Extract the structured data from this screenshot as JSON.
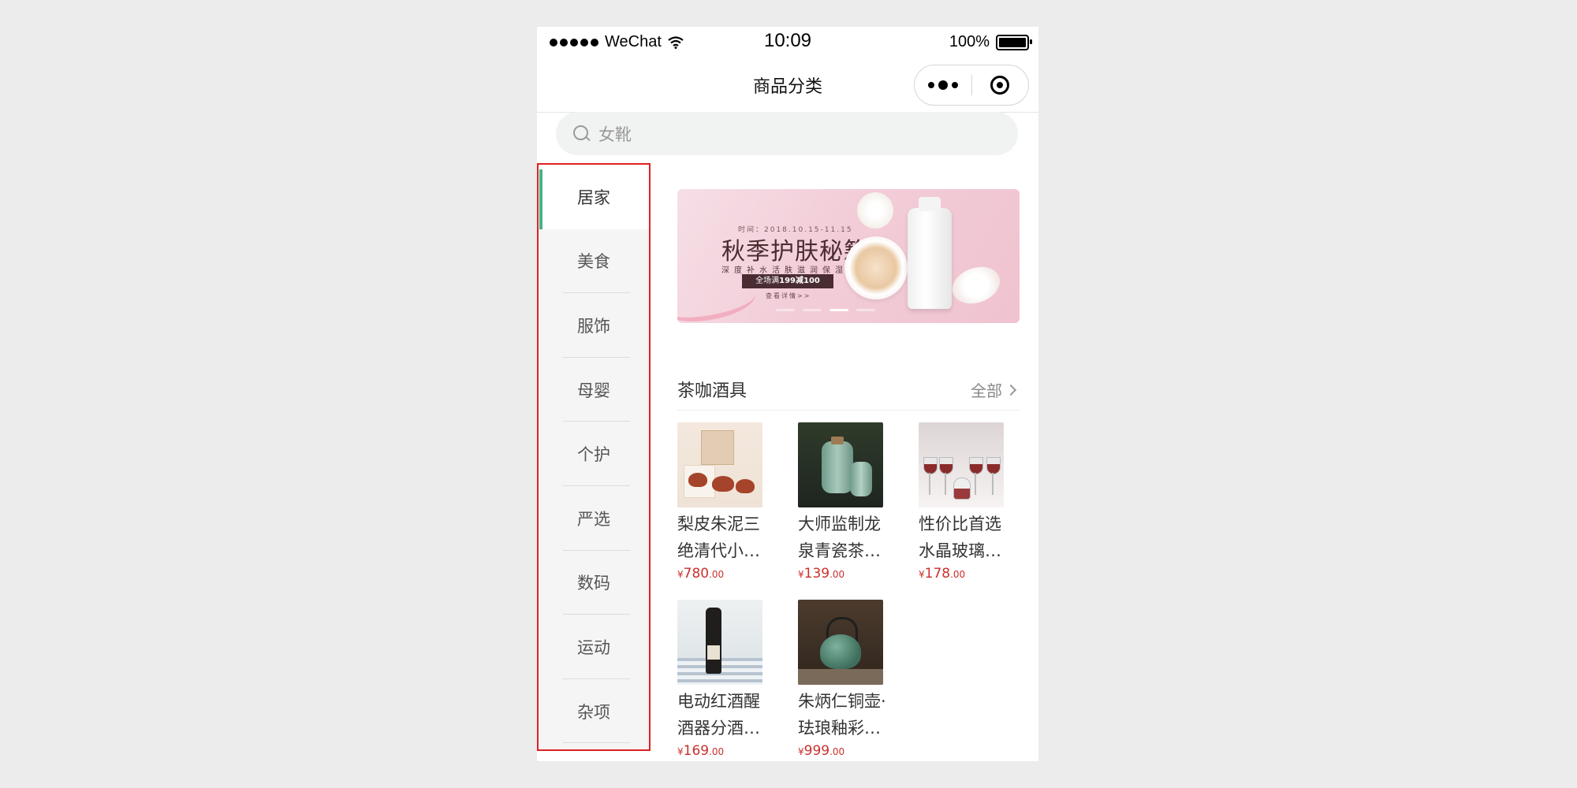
{
  "status_bar": {
    "carrier": "WeChat",
    "time": "10:09",
    "battery": "100%"
  },
  "navbar": {
    "title": "商品分类"
  },
  "search": {
    "placeholder": "女靴"
  },
  "sidebar": {
    "items": [
      {
        "label": "居家",
        "active": true
      },
      {
        "label": "美食"
      },
      {
        "label": "服饰"
      },
      {
        "label": "母婴"
      },
      {
        "label": "个护"
      },
      {
        "label": "严选"
      },
      {
        "label": "数码"
      },
      {
        "label": "运动"
      },
      {
        "label": "杂项"
      }
    ]
  },
  "banner": {
    "date": "时间：2018.10.15-11.15",
    "headline": "秋季护肤秘籍",
    "sub": "深度补水活肤滋润保湿",
    "promo_prefix": "全场满",
    "promo_value": "199减100",
    "more": "查看详情>>"
  },
  "section": {
    "title": "茶咖酒具",
    "all_label": "全部"
  },
  "products": [
    {
      "name": "梨皮朱泥三绝清代小…",
      "currency": "¥",
      "price_int": "780",
      "price_dec": ".00"
    },
    {
      "name": "大师监制龙泉青瓷茶…",
      "currency": "¥",
      "price_int": "139",
      "price_dec": ".00"
    },
    {
      "name": "性价比首选水晶玻璃…",
      "currency": "¥",
      "price_int": "178",
      "price_dec": ".00"
    },
    {
      "name": "电动红酒醒酒器分酒…",
      "currency": "¥",
      "price_int": "169",
      "price_dec": ".00"
    },
    {
      "name": "朱炳仁铜壶·珐琅釉彩…",
      "currency": "¥",
      "price_int": "999",
      "price_dec": ".00"
    }
  ],
  "colors": {
    "accent": "#44b383",
    "price": "#c9302c",
    "highlight_border": "#e02020"
  }
}
